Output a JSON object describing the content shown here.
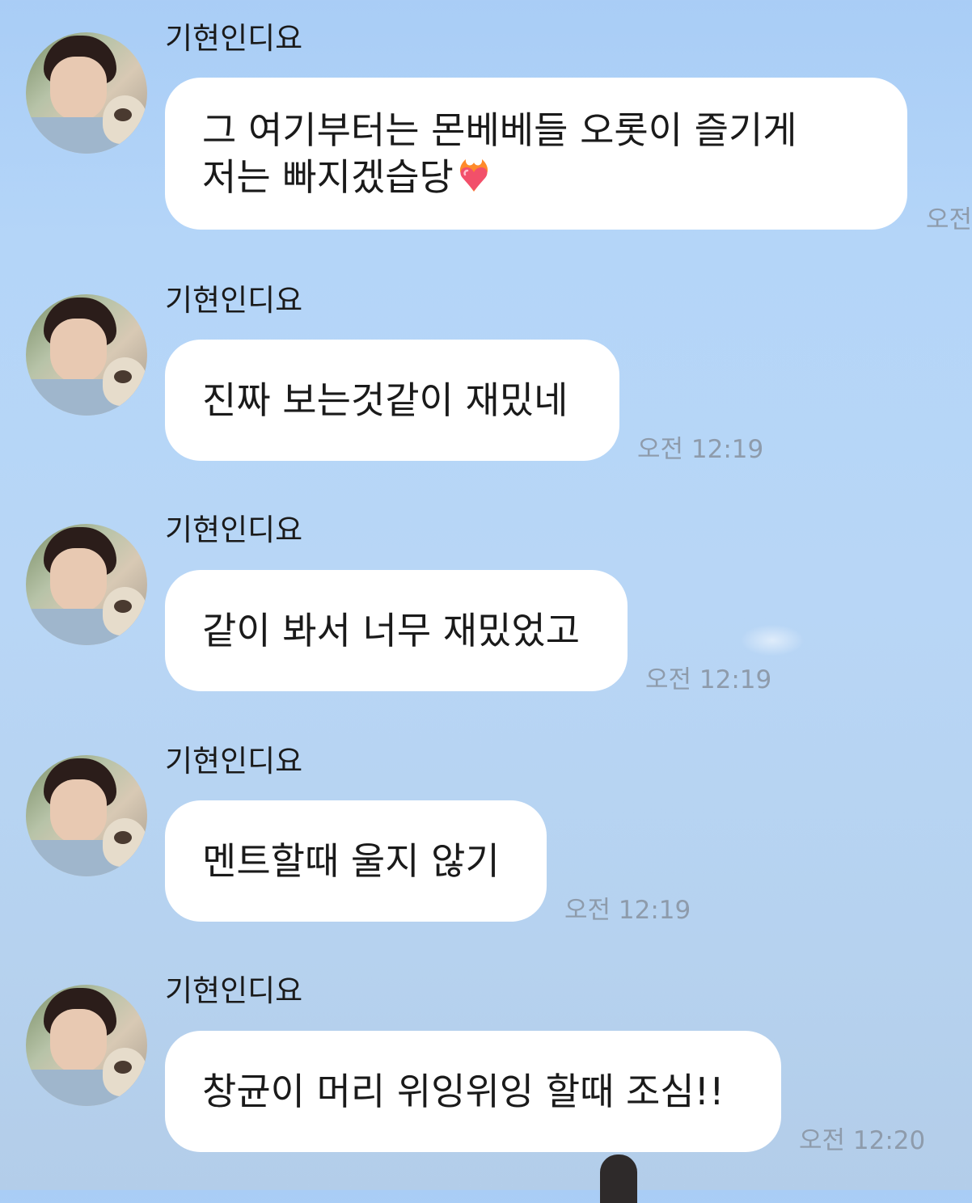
{
  "messages": [
    {
      "sender": "기현인디요",
      "lines": [
        "그 여기부터는 몬베베들 오롯이 즐기게",
        "저는 빠지겠습당"
      ],
      "emoji": "heart-on-fire",
      "time": "오전"
    },
    {
      "sender": "기현인디요",
      "lines": [
        "진짜 보는것같이 재밌네"
      ],
      "time": "오전 12:19"
    },
    {
      "sender": "기현인디요",
      "lines": [
        "같이 봐서 너무 재밌었고"
      ],
      "time": "오전 12:19"
    },
    {
      "sender": "기현인디요",
      "lines": [
        "멘트할때 울지 않기"
      ],
      "time": "오전 12:19"
    },
    {
      "sender": "기현인디요",
      "lines": [
        "창균이 머리 위잉위잉 할때 조심!!"
      ],
      "time": "오전 12:20"
    }
  ]
}
